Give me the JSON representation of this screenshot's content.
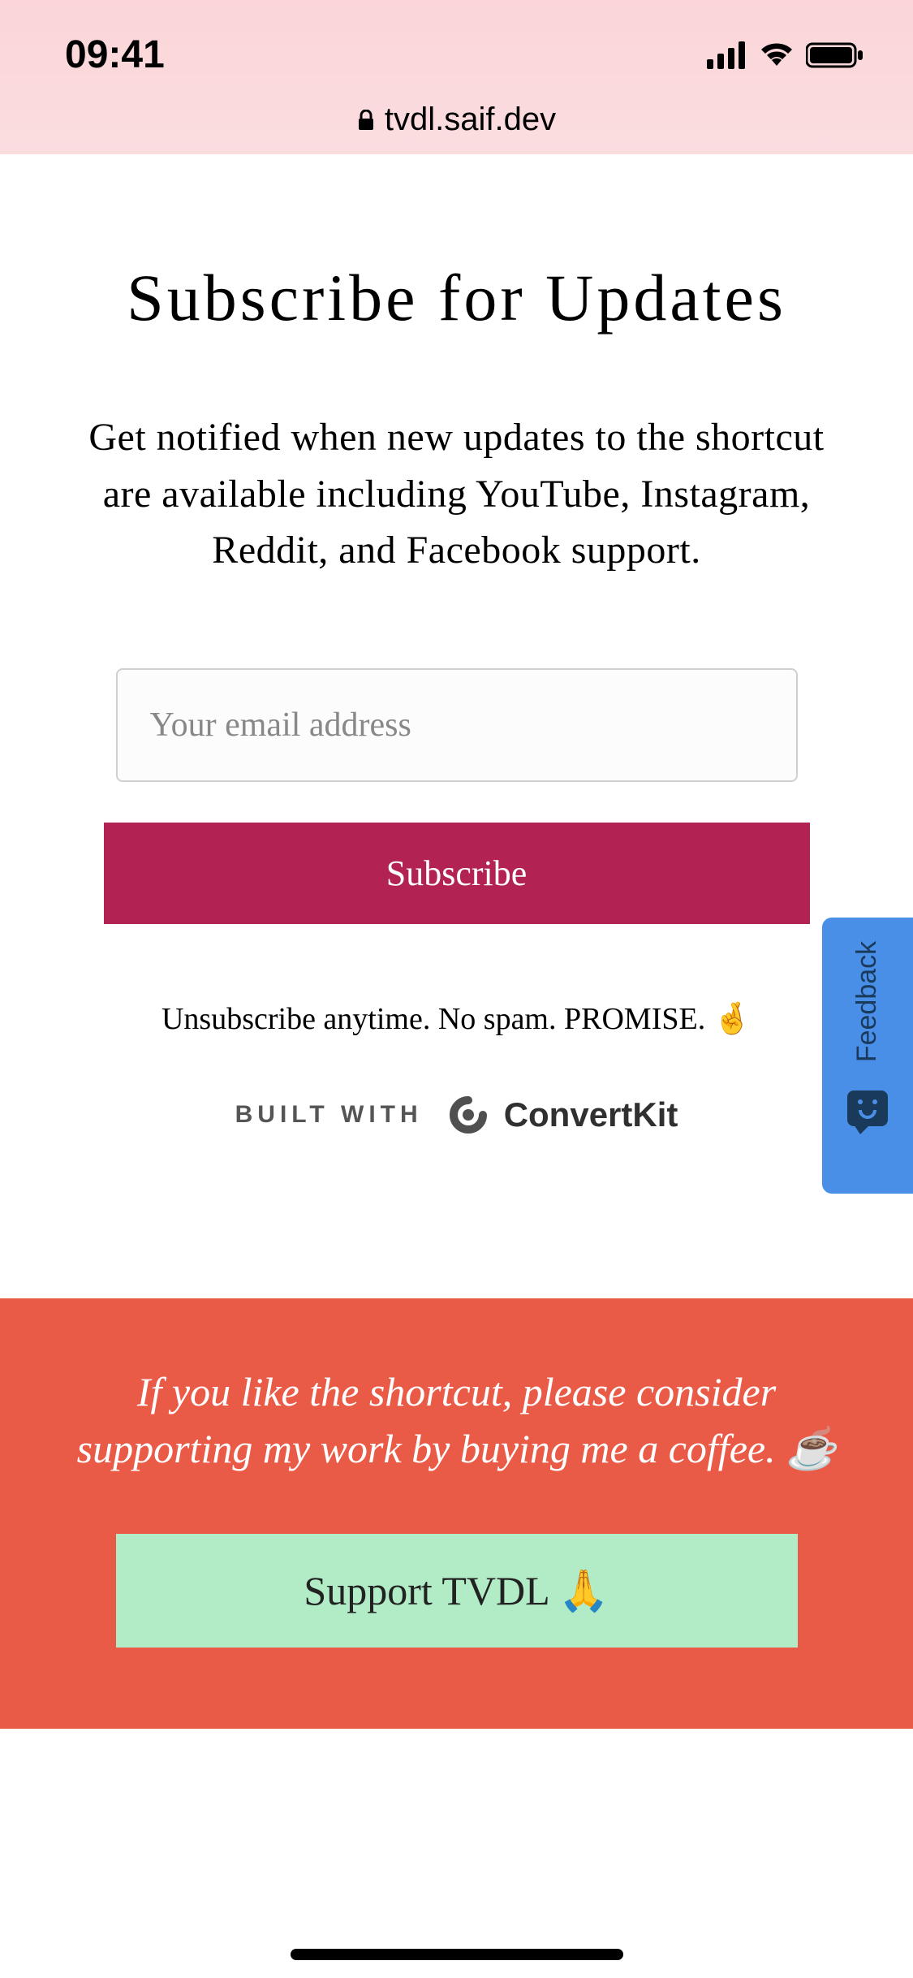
{
  "status": {
    "time": "09:41",
    "url": "tvdl.saif.dev"
  },
  "subscribe": {
    "heading": "Subscribe for Updates",
    "subtitle": "Get notified when new updates to the shortcut are available including YouTube, Instagram, Reddit, and Facebook support.",
    "email_placeholder": "Your email address",
    "button": "Subscribe",
    "disclaimer": "Unsubscribe anytime. No spam. PROMISE. 🤞",
    "built_with_label": "BUILT WITH",
    "provider": "ConvertKit"
  },
  "support": {
    "text": "If you like the shortcut, please consider supporting my work by buying me a coffee. ☕",
    "button": "Support TVDL 🙏"
  },
  "feedback": {
    "label": "Feedback"
  }
}
